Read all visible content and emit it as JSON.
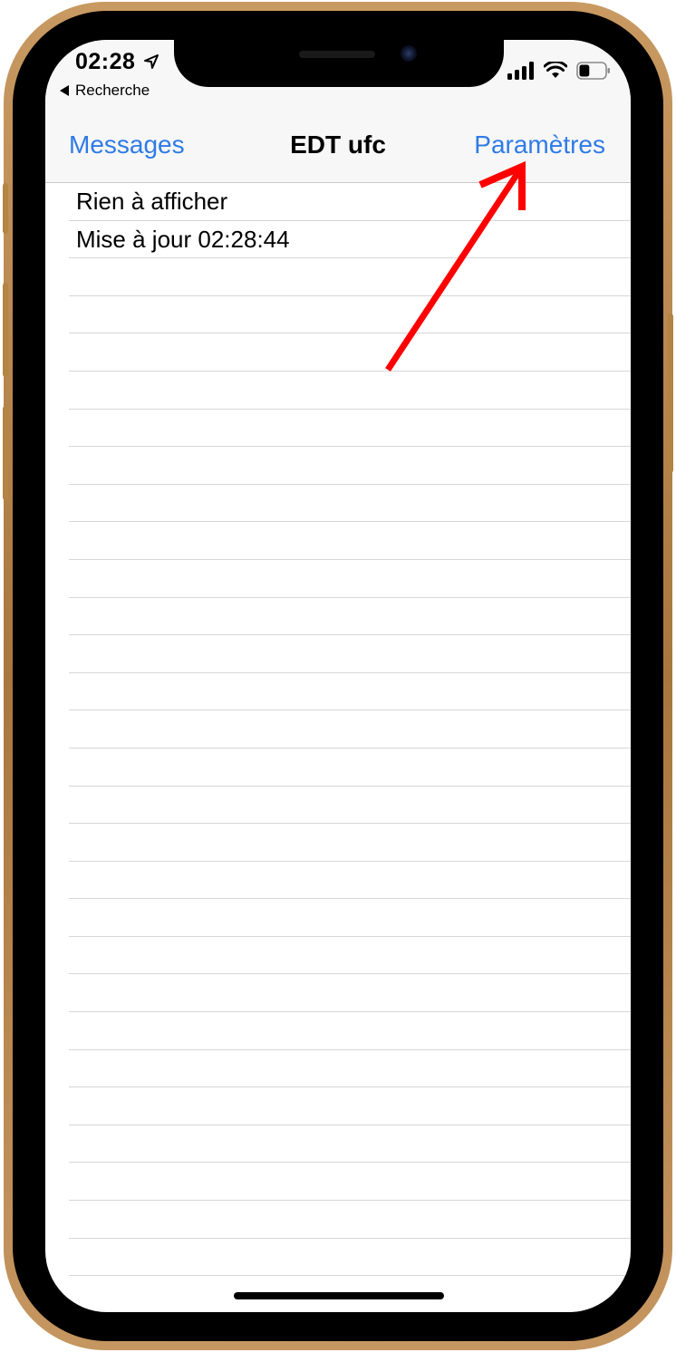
{
  "status_bar": {
    "time": "02:28",
    "back_app_label": "Recherche",
    "battery_level": 0.4
  },
  "nav_bar": {
    "back_label": "Messages",
    "title": "EDT ufc",
    "right_label": "Paramètres"
  },
  "list": {
    "rows": [
      "Rien à afficher",
      "Mise à jour 02:28:44"
    ],
    "empty_rows": 27
  },
  "annotation": {
    "arrow_color": "#ff0000",
    "target": "Paramètres"
  },
  "colors": {
    "accent": "#2f7be6",
    "nav_background": "#f7f7f7",
    "frame_gold": "#b8864a"
  },
  "icons": {
    "location": "location-arrow-icon",
    "back": "back-triangle-icon",
    "signal": "cellular-signal-icon",
    "wifi": "wifi-icon",
    "battery": "battery-icon"
  }
}
